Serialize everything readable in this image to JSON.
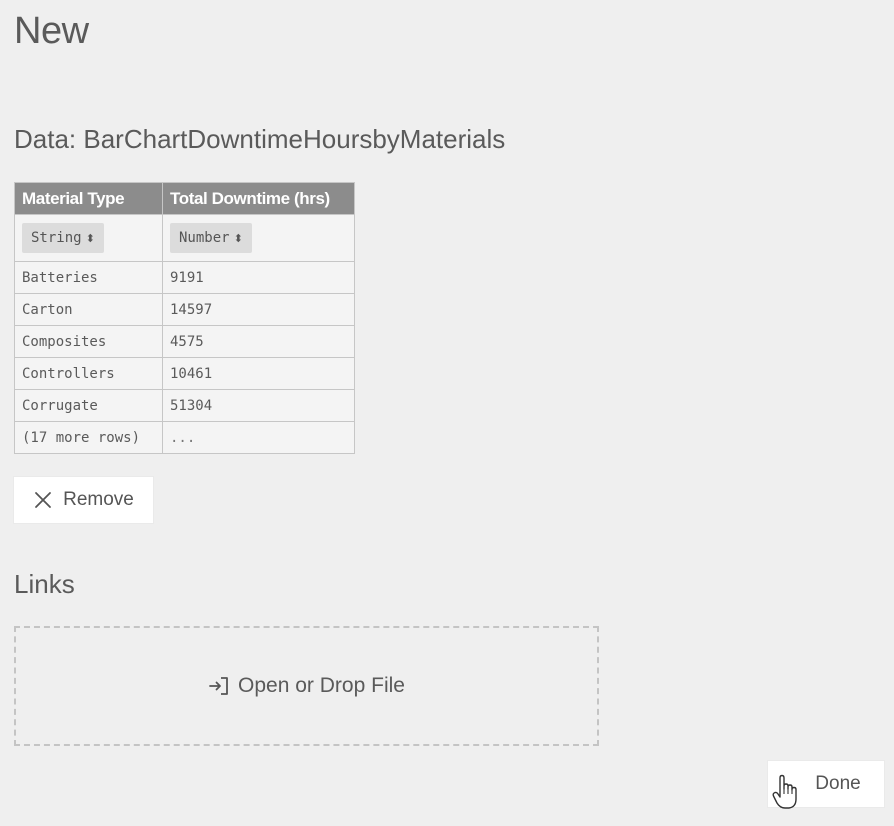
{
  "page": {
    "title": "New"
  },
  "data_section": {
    "title": "Data: BarChartDowntimeHoursbyMaterials",
    "columns": [
      {
        "header": "Material Type",
        "type": "String"
      },
      {
        "header": "Total Downtime (hrs)",
        "type": "Number"
      }
    ],
    "type_caret": "⬍",
    "rows": [
      [
        "Batteries",
        "9191"
      ],
      [
        "Carton",
        "14597"
      ],
      [
        "Composites",
        "4575"
      ],
      [
        "Controllers",
        "10461"
      ],
      [
        "Corrugate",
        "51304"
      ]
    ],
    "more_rows": [
      "(17 more rows)",
      "..."
    ],
    "remove_label": "Remove"
  },
  "links_section": {
    "title": "Links",
    "drop_label": "Open or Drop File"
  },
  "footer": {
    "done_label": "Done"
  },
  "icons": {
    "remove": "close-icon",
    "drop": "open-file-icon",
    "cursor": "hand-cursor-icon"
  }
}
